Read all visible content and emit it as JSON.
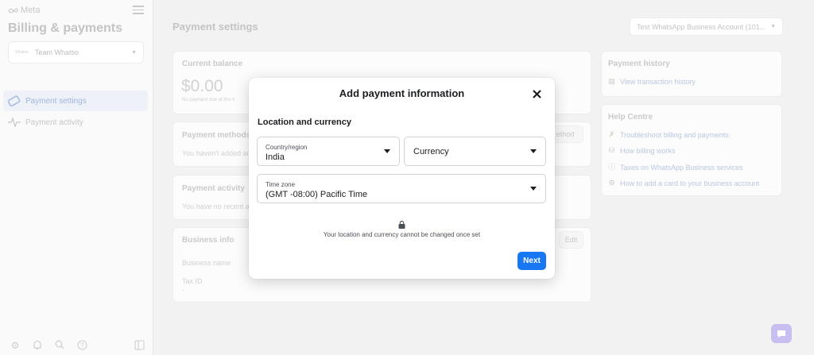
{
  "sidebar": {
    "logo": "Meta",
    "title": "Billing & payments",
    "account": {
      "logo_text": "Whatso",
      "name": "Team Whatso"
    },
    "nav": [
      {
        "label": "Payment settings",
        "icon": "credit-card-icon"
      },
      {
        "label": "Payment activity",
        "icon": "activity-pulse-icon"
      }
    ],
    "footer_icons": [
      "settings-icon",
      "bell-icon",
      "search-icon",
      "help-icon",
      "panel-toggle-icon"
    ]
  },
  "header": {
    "title": "Payment settings",
    "account_dropdown": "Test WhatsApp Business Account (101..."
  },
  "cards": {
    "balance": {
      "title": "Current balance",
      "amount": "$0.00",
      "note": "No payment due at this ti"
    },
    "methods": {
      "title": "Payment methods",
      "note": "You haven't added an",
      "button": "ethod"
    },
    "activity": {
      "title": "Payment activity",
      "note": "You have no recent ac"
    },
    "business": {
      "title": "Business info",
      "edit": "Edit",
      "name_label": "Business name",
      "tax_label": "Tax ID",
      "tax_value": "-"
    }
  },
  "right_panel": {
    "history": {
      "title": "Payment history",
      "link": "View transaction history"
    },
    "help": {
      "title": "Help Centre",
      "links": [
        {
          "label": "Troubleshoot billing and payments",
          "icon": "wrench-icon"
        },
        {
          "label": "How billing works",
          "icon": "coins-icon"
        },
        {
          "label": "Taxes on WhatsApp Business services",
          "icon": "info-icon"
        },
        {
          "label": "How to add a card to your business account",
          "icon": "gear-icon"
        }
      ]
    }
  },
  "modal": {
    "title": "Add payment information",
    "section": "Location and currency",
    "country": {
      "label": "Country/region",
      "value": "India"
    },
    "currency": {
      "placeholder": "Currency"
    },
    "timezone": {
      "label": "Time zone",
      "value": "(GMT -08:00) Pacific Time"
    },
    "note": "Your location and currency cannot be changed once set",
    "next_label": "Next"
  },
  "colors": {
    "primary": "#1877f2",
    "text": "#1c1e21"
  }
}
